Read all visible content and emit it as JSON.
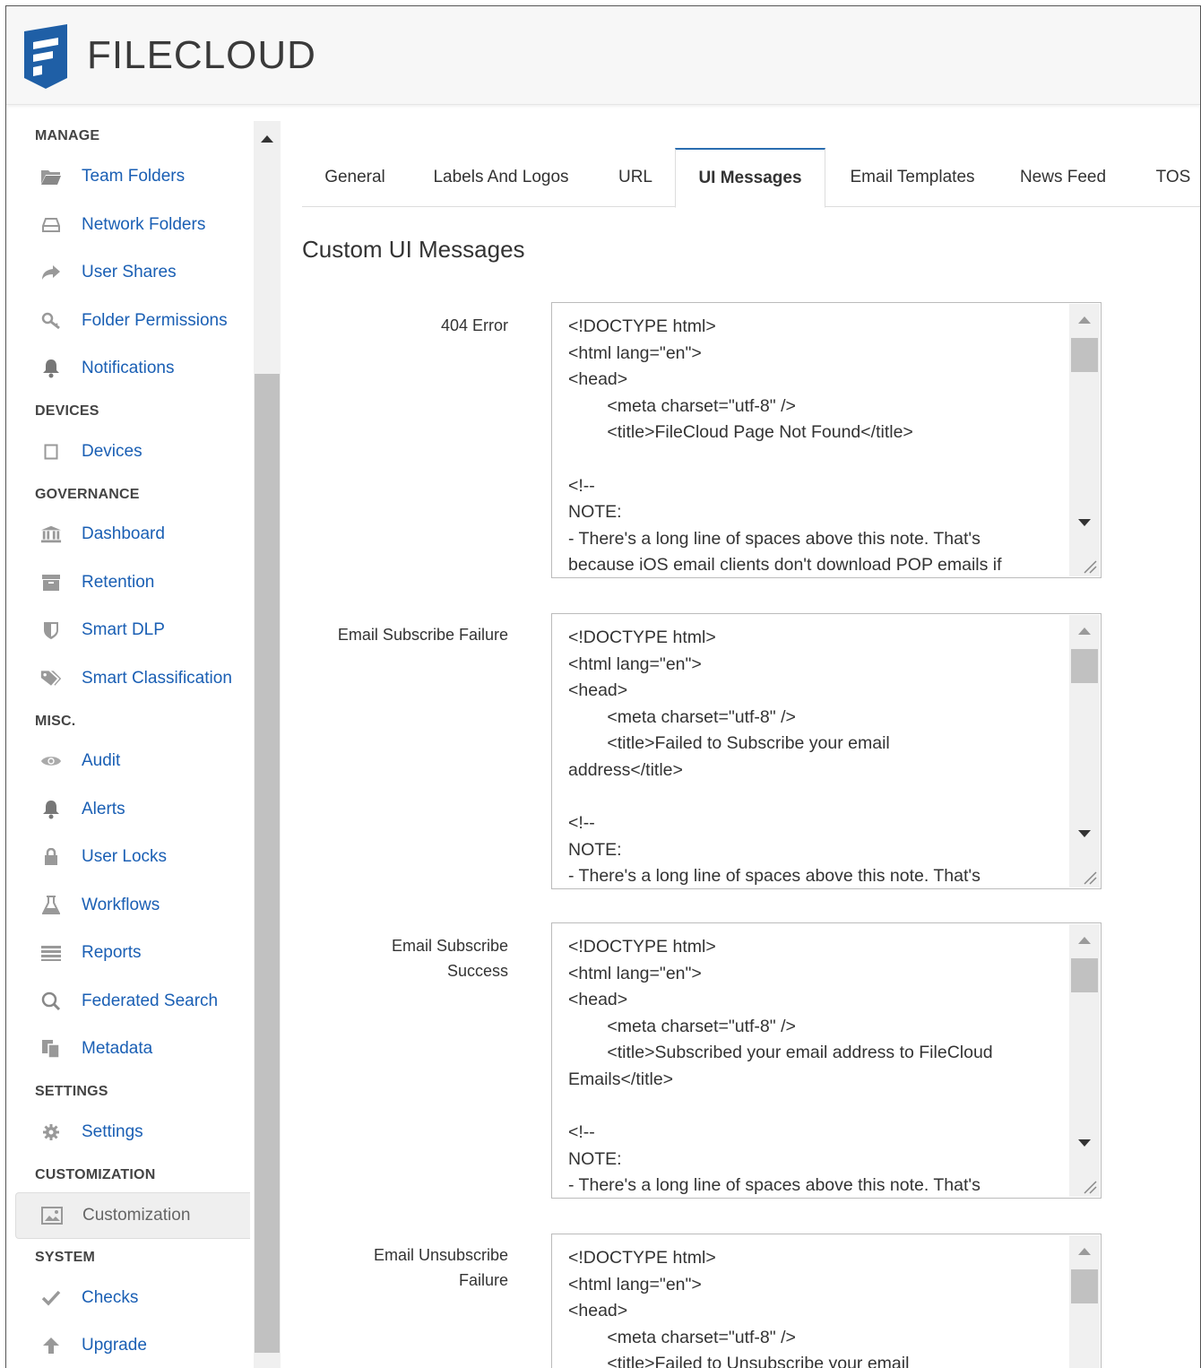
{
  "app": {
    "name": "FILECLOUD"
  },
  "sidebar": {
    "sections": [
      {
        "title": "MANAGE",
        "items": [
          {
            "label": "Team Folders",
            "icon": "folder-open-icon"
          },
          {
            "label": "Network Folders",
            "icon": "hdd-icon"
          },
          {
            "label": "User Shares",
            "icon": "share-arrow-icon"
          },
          {
            "label": "Folder Permissions",
            "icon": "key-search-icon"
          },
          {
            "label": "Notifications",
            "icon": "bell-icon"
          }
        ]
      },
      {
        "title": "DEVICES",
        "items": [
          {
            "label": "Devices",
            "icon": "tablet-icon"
          }
        ]
      },
      {
        "title": "GOVERNANCE",
        "items": [
          {
            "label": "Dashboard",
            "icon": "bank-icon"
          },
          {
            "label": "Retention",
            "icon": "archive-icon"
          },
          {
            "label": "Smart DLP",
            "icon": "shield-icon"
          },
          {
            "label": "Smart Classification",
            "icon": "tags-icon"
          }
        ]
      },
      {
        "title": "MISC.",
        "items": [
          {
            "label": "Audit",
            "icon": "eye-icon"
          },
          {
            "label": "Alerts",
            "icon": "bell-icon"
          },
          {
            "label": "User Locks",
            "icon": "lock-icon"
          },
          {
            "label": "Workflows",
            "icon": "flask-icon"
          },
          {
            "label": "Reports",
            "icon": "list-icon"
          },
          {
            "label": "Federated Search",
            "icon": "search-icon"
          },
          {
            "label": "Metadata",
            "icon": "copy-icon"
          }
        ]
      },
      {
        "title": "SETTINGS",
        "items": [
          {
            "label": "Settings",
            "icon": "gear-icon"
          }
        ]
      },
      {
        "title": "CUSTOMIZATION",
        "items": [
          {
            "label": "Customization",
            "icon": "picture-icon",
            "active": true
          }
        ]
      },
      {
        "title": "SYSTEM",
        "items": [
          {
            "label": "Checks",
            "icon": "check-icon"
          },
          {
            "label": "Upgrade",
            "icon": "arrow-up-icon"
          }
        ]
      }
    ]
  },
  "tabs": [
    "General",
    "Labels And Logos",
    "URL",
    "UI Messages",
    "Email Templates",
    "News Feed",
    "TOS"
  ],
  "active_tab": "UI Messages",
  "page": {
    "heading": "Custom UI Messages"
  },
  "messages": [
    {
      "label": "404 Error",
      "value": "<!DOCTYPE html>\n<html lang=\"en\">\n<head>\n        <meta charset=\"utf-8\" />\n        <title>FileCloud Page Not Found</title>\n\n<!--\nNOTE:\n- There's a long line of spaces above this note. That's\nbecause iOS email clients don't download POP emails if"
    },
    {
      "label": "Email Subscribe Failure",
      "value": "<!DOCTYPE html>\n<html lang=\"en\">\n<head>\n        <meta charset=\"utf-8\" />\n        <title>Failed to Subscribe your email\naddress</title>\n\n<!--\nNOTE:\n- There's a long line of spaces above this note. That's"
    },
    {
      "label": "Email Subscribe Success",
      "value": "<!DOCTYPE html>\n<html lang=\"en\">\n<head>\n        <meta charset=\"utf-8\" />\n        <title>Subscribed your email address to FileCloud\nEmails</title>\n\n<!--\nNOTE:\n- There's a long line of spaces above this note. That's"
    },
    {
      "label": "Email Unsubscribe Failure",
      "value": "<!DOCTYPE html>\n<html lang=\"en\">\n<head>\n        <meta charset=\"utf-8\" />\n        <title>Failed to Unsubscribe your email"
    }
  ]
}
